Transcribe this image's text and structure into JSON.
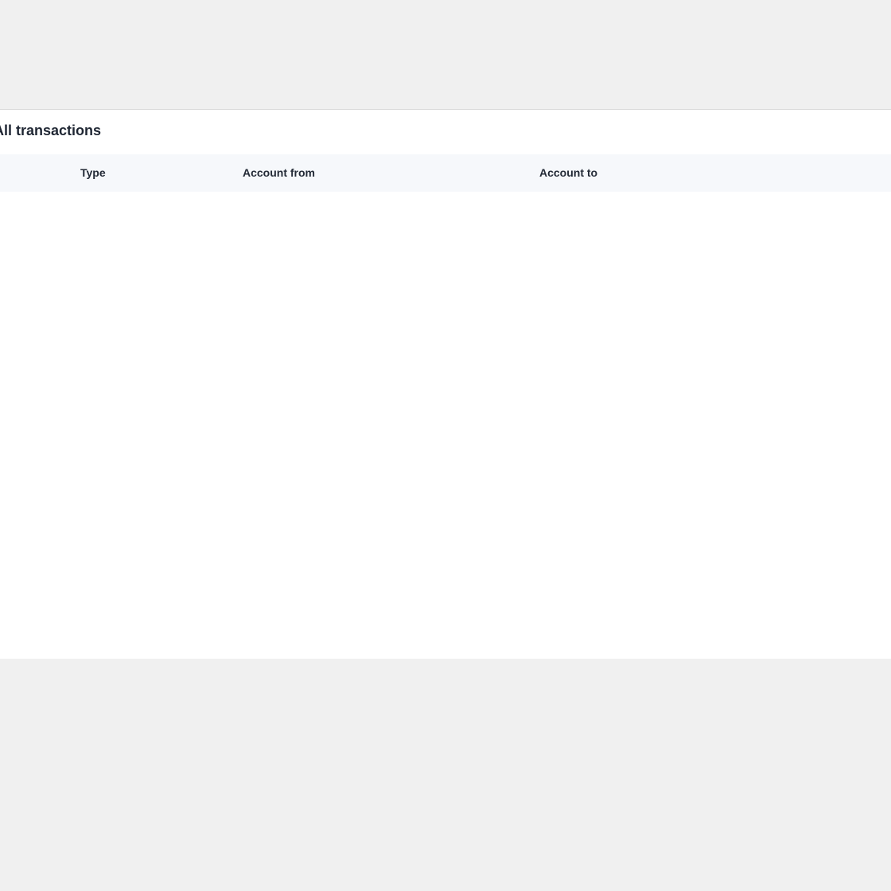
{
  "transactions_panel": {
    "title": "All transactions",
    "columns": [
      {
        "label": "Type"
      },
      {
        "label": "Account from"
      },
      {
        "label": "Account to"
      }
    ],
    "rows": []
  }
}
